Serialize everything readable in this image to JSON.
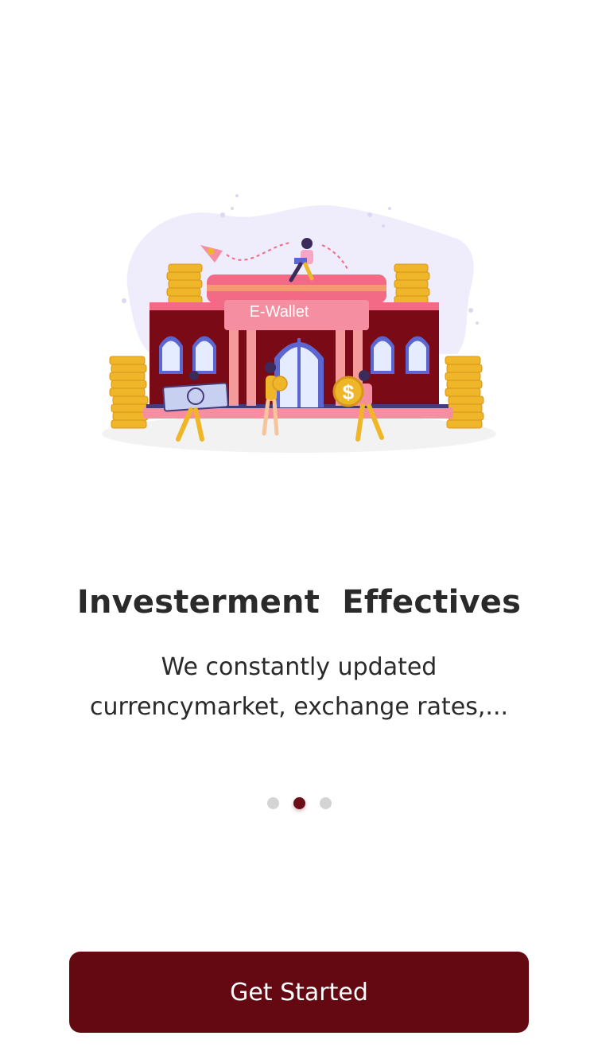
{
  "illustration": {
    "sign_text": "E-Wallet",
    "dollar_symbol": "$"
  },
  "onboarding": {
    "title": "Investerment  Effectives",
    "description": "We constantly updated currencymarket, exchange rates,..."
  },
  "pager": {
    "pages": 3,
    "active_index": 1
  },
  "actions": {
    "get_started_label": "Get Started"
  },
  "colors": {
    "primary": "#640912",
    "dot_inactive": "#d4d4d4",
    "gold": "#f0b62a",
    "building": "#7a0b16",
    "pink": "#f26a86"
  }
}
